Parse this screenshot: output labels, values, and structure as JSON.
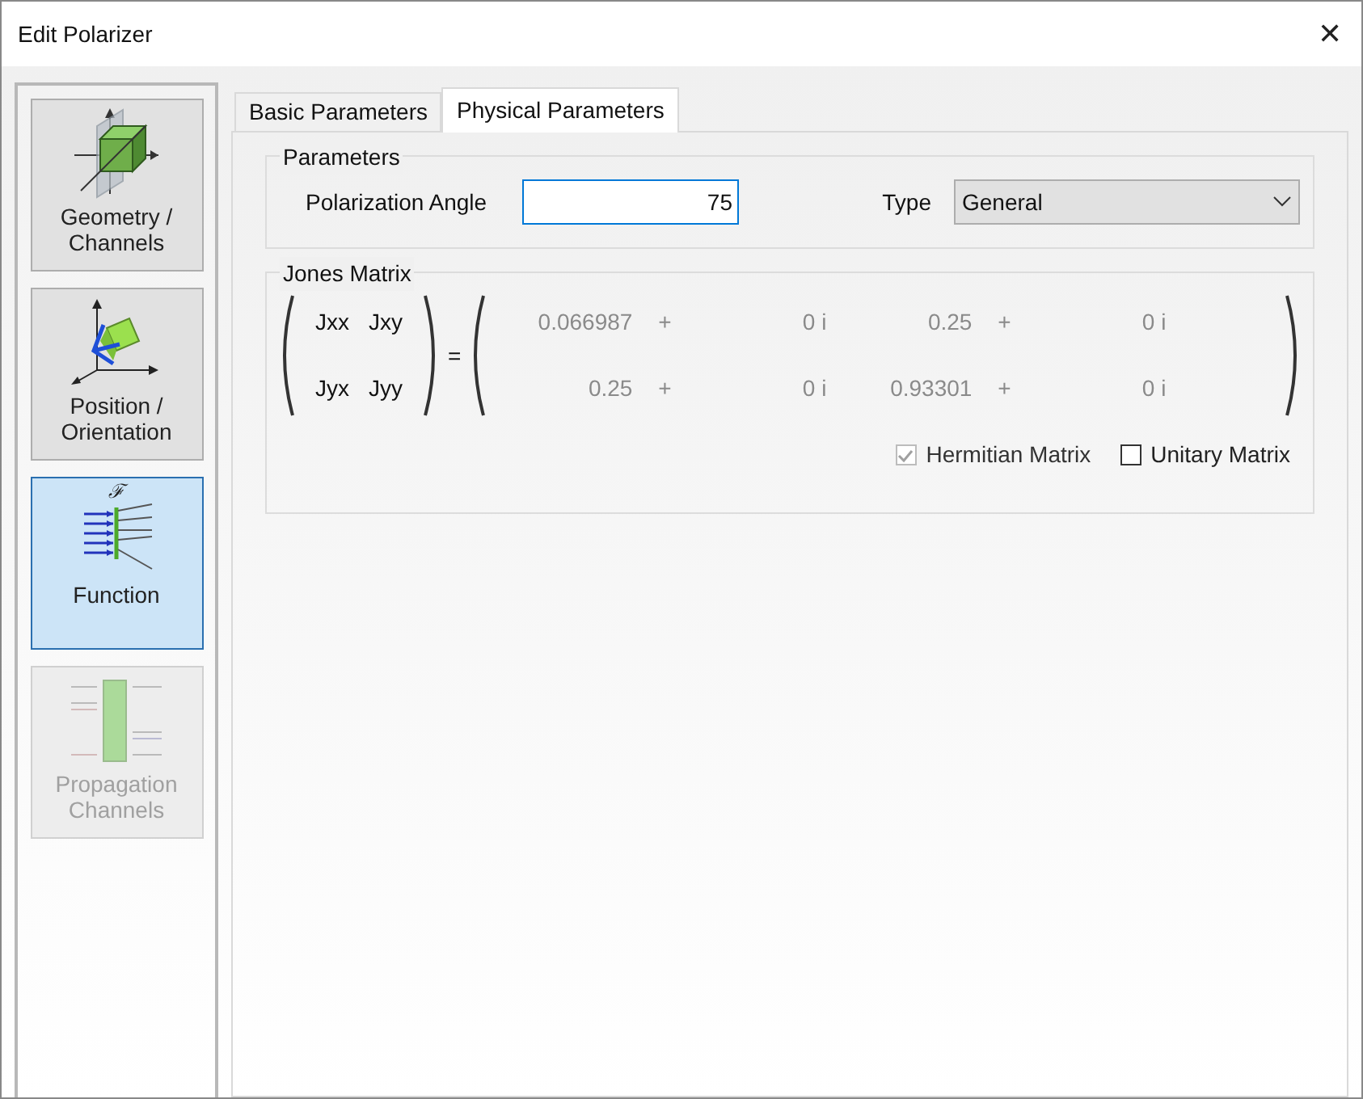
{
  "window": {
    "title": "Edit Polarizer",
    "close": "✕"
  },
  "sidebar": {
    "items": [
      {
        "kind": "geometry",
        "label": "Geometry / Channels",
        "selected": false,
        "disabled": false
      },
      {
        "kind": "position",
        "label": "Position / Orientation",
        "selected": false,
        "disabled": false
      },
      {
        "kind": "function",
        "glyph": "ℱ",
        "label": "Function",
        "selected": true,
        "disabled": false
      },
      {
        "kind": "propagation",
        "label": "Propagation Channels",
        "selected": false,
        "disabled": true
      }
    ]
  },
  "tabs": [
    {
      "label": "Basic Parameters",
      "selected": false
    },
    {
      "label": "Physical Parameters",
      "selected": true
    }
  ],
  "parameters": {
    "title": "Parameters",
    "angle_label": "Polarization Angle",
    "angle_value": "75",
    "type_label": "Type",
    "type_value": "General"
  },
  "jones": {
    "title": "Jones Matrix",
    "symbols": [
      [
        "Jxx",
        "Jxy"
      ],
      [
        "Jyx",
        "Jyy"
      ]
    ],
    "equals": "=",
    "rows": [
      [
        {
          "real": "0.066987",
          "plus": "+",
          "imag": "0 i"
        },
        {
          "real": "0.25",
          "plus": "+",
          "imag": "0 i"
        }
      ],
      [
        {
          "real": "0.25",
          "plus": "+",
          "imag": "0 i"
        },
        {
          "real": "0.93301",
          "plus": "+",
          "imag": "0 i"
        }
      ]
    ],
    "options": [
      {
        "label": "Hermitian Matrix",
        "checked": true,
        "disabled": true
      },
      {
        "label": "Unitary Matrix",
        "checked": false,
        "disabled": false
      }
    ]
  }
}
